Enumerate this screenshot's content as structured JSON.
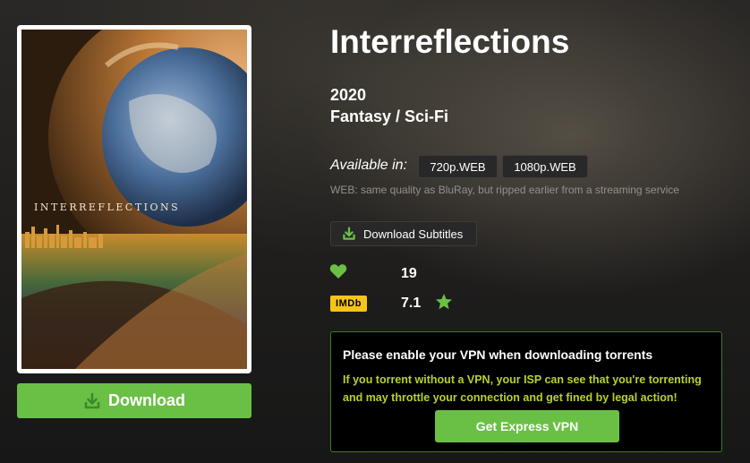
{
  "movie": {
    "title": "Interreflections",
    "year": "2020",
    "genres": "Fantasy / Sci-Fi",
    "poster_title": "INTERREFLECTIONS"
  },
  "download": {
    "label": "Download",
    "icon": "download-icon"
  },
  "availability": {
    "label": "Available in:",
    "qualities": [
      "720p.WEB",
      "1080p.WEB"
    ],
    "note": "WEB: same quality as BluRay, but ripped earlier from a streaming service"
  },
  "subtitles": {
    "label": "Download Subtitles",
    "icon": "download-icon"
  },
  "stats": {
    "likes": "19",
    "imdb_badge": "IMDb",
    "imdb_rating": "7.1"
  },
  "vpn": {
    "title": "Please enable your VPN when downloading torrents",
    "message": "If you torrent without a VPN, your ISP can see that you're torrenting and may throttle your connection and get fined by legal action!",
    "button": "Get Express VPN"
  },
  "colors": {
    "accent": "#6ac045",
    "warning_text": "#b5d22e",
    "imdb_yellow": "#f5c518"
  }
}
